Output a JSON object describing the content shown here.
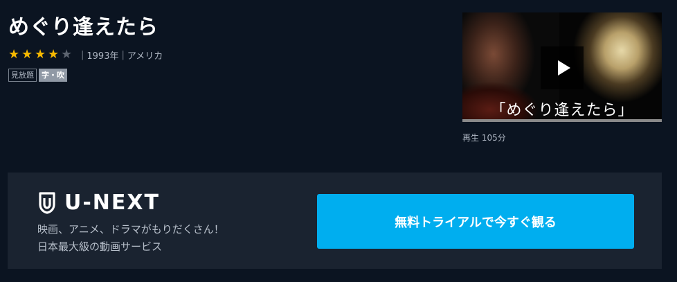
{
  "title": "めぐり逢えたら",
  "rating": {
    "value": 4,
    "max": 5,
    "icon": "star-icon",
    "color": "#f5b800"
  },
  "meta": {
    "separator": "|",
    "year": "1993年",
    "country": "アメリカ"
  },
  "tags": [
    "見放題",
    "字・吹"
  ],
  "thumbnail": {
    "caption": "「めぐり逢えたら」",
    "play_icon": "play-icon"
  },
  "duration": "再生 105分",
  "banner": {
    "logo": "U-NEXT",
    "tagline_line1": "映画、アニメ、ドラマがもりだくさん！",
    "tagline_line2": "日本最大級の動画サービス",
    "cta": "無料トライアルで今すぐ観る"
  },
  "colors": {
    "background": "#0b1421",
    "banner": "#1a2330",
    "accent": "#00aeef"
  }
}
